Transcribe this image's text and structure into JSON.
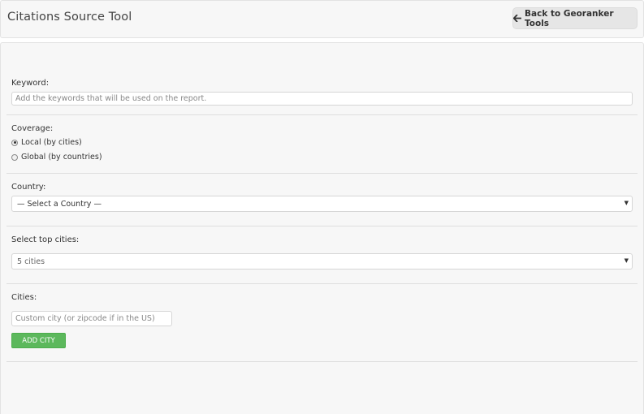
{
  "header": {
    "title": "Citations Source Tool",
    "back_label": "Back to Georanker Tools"
  },
  "keyword": {
    "label": "Keyword:",
    "placeholder": "Add the keywords that will be used on the report."
  },
  "coverage": {
    "label": "Coverage:",
    "options": [
      {
        "label": "Local (by cities)",
        "checked": true
      },
      {
        "label": "Global (by countries)",
        "checked": false
      }
    ]
  },
  "country": {
    "label": "Country:",
    "selected": "— Select a Country —"
  },
  "top_cities": {
    "label": "Select top cities:",
    "selected": "5 cities"
  },
  "cities": {
    "label": "Cities:",
    "placeholder": "Custom city (or zipcode if in the US)",
    "add_label": "ADD CITY"
  },
  "colors": {
    "accent_green": "#5cb85c",
    "panel_bg": "#f7f7f7"
  },
  "icons": {
    "back": "arrow-left-icon",
    "dropdown": "caret-down-icon"
  }
}
